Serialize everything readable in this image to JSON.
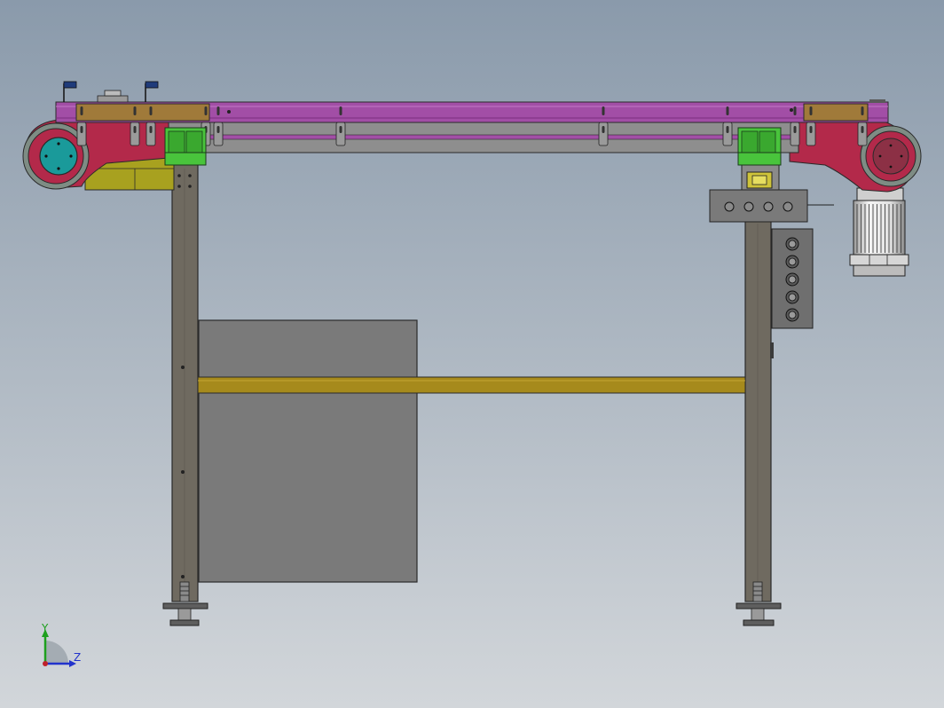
{
  "view": {
    "name": "cad-graphics-viewport",
    "background_top": "#8a9aab",
    "background_bottom": "#d2d6da"
  },
  "colors": {
    "conveyor_beam": "#a24ea6",
    "conveyor_beam_dark": "#7a2f7d",
    "belt_track": "#8e8e8e",
    "end_plate": "#b3294a",
    "drive_roller_hub": "#1a9a9a",
    "idler_hub": "#8c3045",
    "roller_shell": "#7e8c84",
    "guide_bracket": "#a07a3a",
    "bearing_block": "#49c43c",
    "leg": "#6f6a60",
    "cross_bar": "#a68a1c",
    "tension_block": "#a8a11f",
    "cabinet_panel": "#7a7a7a",
    "control_box": "#6f6f6f",
    "motor": "#ececec",
    "foot": "#5e5e5e",
    "sensor_flag": "#1f3b7a",
    "triad_y": "#1ea01e",
    "triad_z": "#2233cc",
    "triad_origin": "#c0202a"
  },
  "icons": {
    "axis_triad": "xyz-orientation-triad",
    "push_button": "round-push-button",
    "sensor": "photo-sensor-flag"
  },
  "control_box": {
    "buttons_horizontal": 4,
    "buttons_vertical": 5
  },
  "triad": {
    "y_label": "Y",
    "z_label": "Z"
  }
}
